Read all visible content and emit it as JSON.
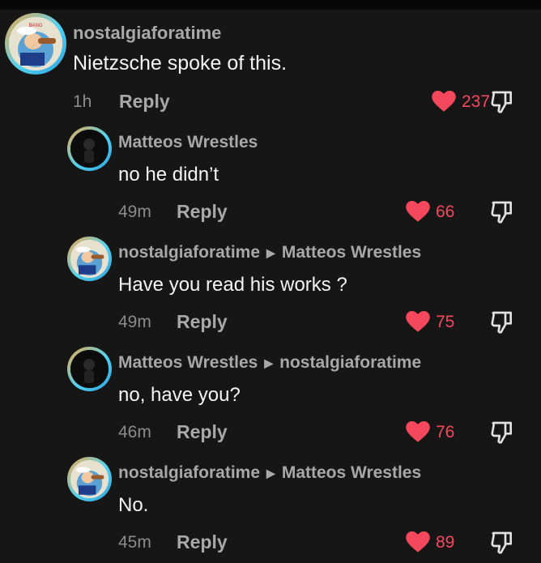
{
  "comments": [
    {
      "username": "nostalgiaforatime",
      "reply_to": "",
      "text": "Nietzsche spoke of this.",
      "time": "1h",
      "reply_label": "Reply",
      "likes": "237",
      "avatar": "popeye-avatar"
    },
    {
      "username": "Matteos Wrestles",
      "reply_to": "",
      "text": "no he didn’t",
      "time": "49m",
      "reply_label": "Reply",
      "likes": "66",
      "avatar": "dark-figure-avatar"
    },
    {
      "username": "nostalgiaforatime",
      "reply_to": "Matteos Wrestles",
      "text": "Have you read his works ?",
      "time": "49m",
      "reply_label": "Reply",
      "likes": "75",
      "avatar": "popeye-avatar"
    },
    {
      "username": "Matteos Wrestles",
      "reply_to": "nostalgiaforatime",
      "text": "no, have you?",
      "time": "46m",
      "reply_label": "Reply",
      "likes": "76",
      "avatar": "dark-figure-avatar"
    },
    {
      "username": "nostalgiaforatime",
      "reply_to": "Matteos Wrestles",
      "text": "No.",
      "time": "45m",
      "reply_label": "Reply",
      "likes": "89",
      "avatar": "popeye-avatar"
    }
  ],
  "colors": {
    "like": "#f5485c",
    "background": "#161616",
    "muted": "#a8a8a8"
  },
  "icons": {
    "like": "heart-icon",
    "dislike": "thumbs-down-icon",
    "reply_arrow": "triangle-right-icon"
  }
}
